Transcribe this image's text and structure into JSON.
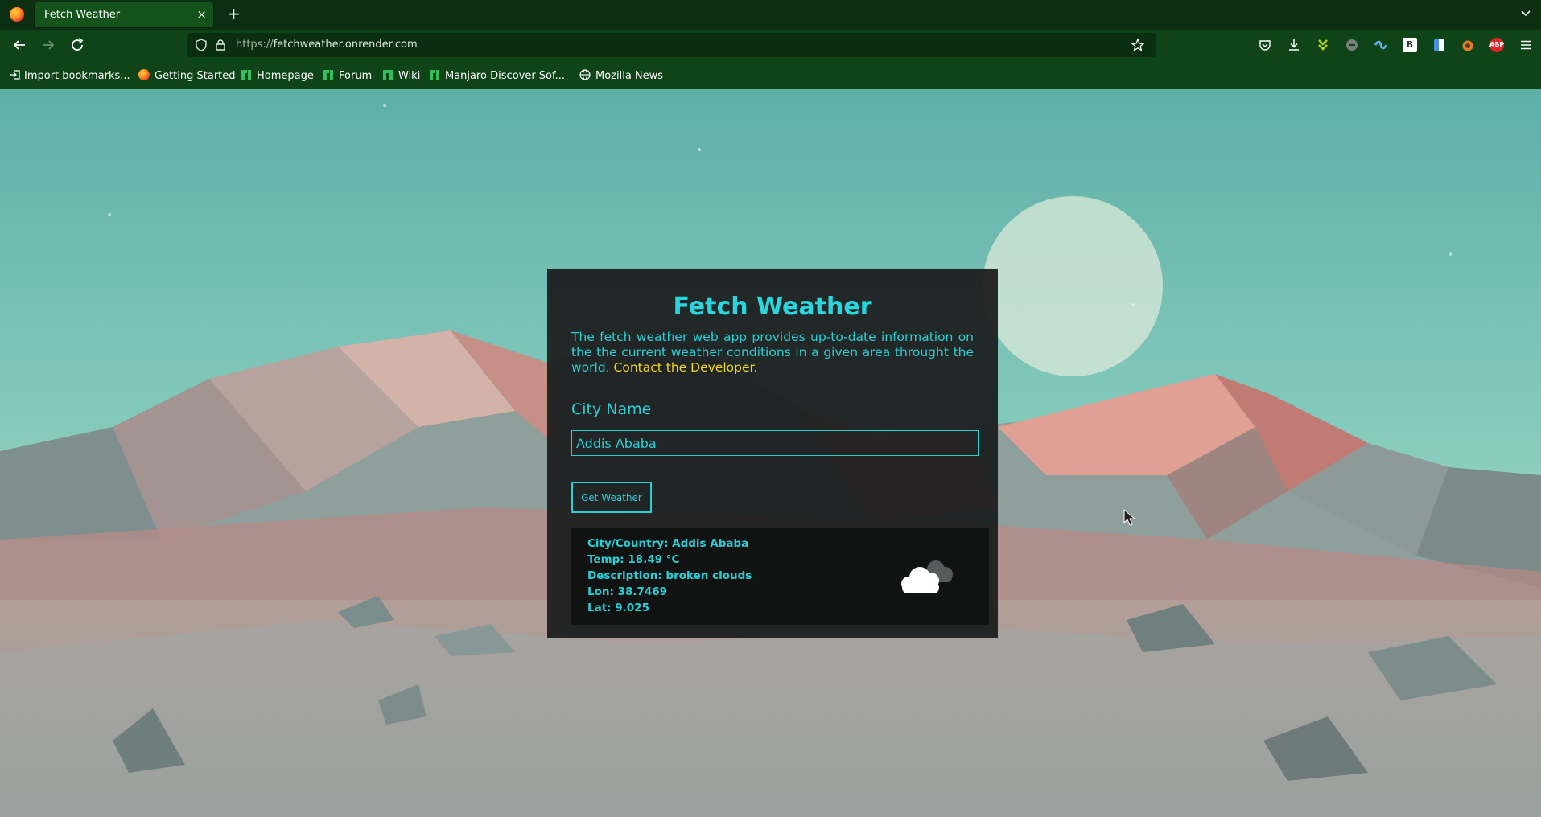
{
  "browser": {
    "tab_title": "Fetch Weather",
    "tab_close": "×",
    "new_tab": "+",
    "url_prefix": "https://",
    "url_host": "fetchweather.onrender.com",
    "bookmarks": [
      {
        "label": "Import bookmarks...",
        "icon": "import-icon"
      },
      {
        "label": "Getting Started",
        "icon": "firefox-icon"
      },
      {
        "label": "Homepage",
        "icon": "manjaro-icon"
      },
      {
        "label": "Forum",
        "icon": "manjaro-icon"
      },
      {
        "label": "Wiki",
        "icon": "manjaro-icon"
      },
      {
        "label": "Manjaro Discover Sof...",
        "icon": "manjaro-icon"
      },
      {
        "label": "Mozilla News",
        "icon": "globe-icon"
      }
    ],
    "extensions": [
      "pocket-icon",
      "download-icon",
      "extension-green-icon",
      "extension-gray-icon",
      "extension-blue-icon",
      "extension-b-icon",
      "extension-doc-icon",
      "extension-orange-icon",
      "adblock-plus-icon",
      "menu-icon"
    ],
    "adblock_label": "ABP",
    "b_ext_label": "B"
  },
  "app": {
    "title": "Fetch Weather",
    "description": "The fetch weather web app provides up-to-date information on the the current weather conditions in a given area throught the world.",
    "contact_link": "Contact the Developer.",
    "city_label": "City Name",
    "city_value": "Addis Ababa",
    "button_label": "Get Weather",
    "result": {
      "city": "City/Country: Addis Ababa",
      "temp": "Temp: 18.49 °C",
      "description": "Description: broken clouds",
      "lon": "Lon: 38.7469",
      "lat": "Lat: 9.025",
      "icon": "broken-clouds-icon"
    }
  },
  "colors": {
    "accent": "#27cfd6",
    "link": "#f1d41f",
    "chrome": "#0f4418"
  }
}
